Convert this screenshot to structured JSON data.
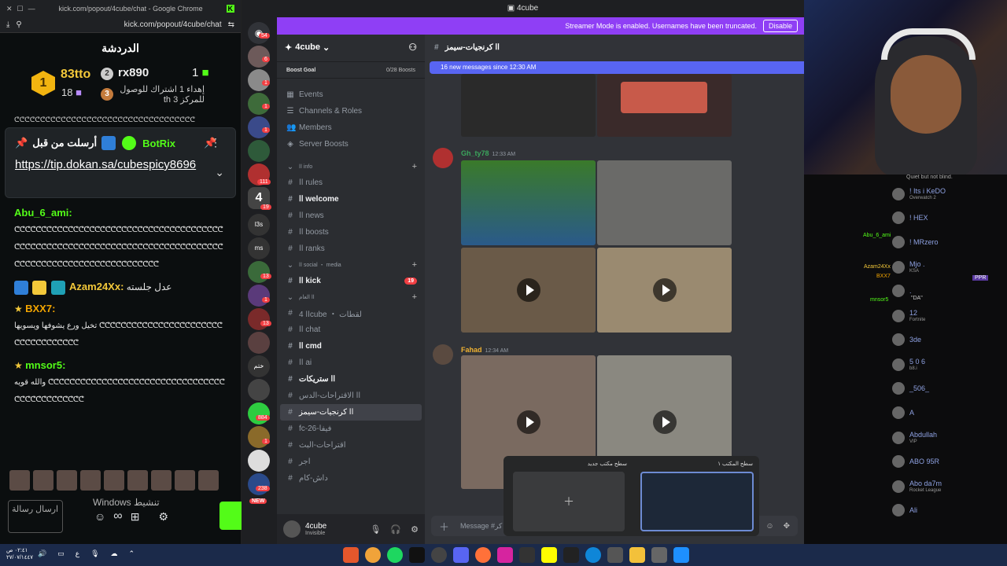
{
  "kick": {
    "chrome_title": "kick.com/popout/4cube/chat - Google Chrome",
    "url": "kick.com/popout/4cube/chat",
    "chat_title": "الدردشة",
    "leaderboard": {
      "first_rank": "1",
      "first_name": "83tto",
      "first_count": "18",
      "second_rank": "2",
      "second_name": "rx890",
      "second_count": "1",
      "third_rank": "3",
      "note": "إهداء 1 اشتراك للوصول للمركز 3 th",
      "separator": "ᕦᕦᕦᕦᕦᕦᕦᕦᕦᕦᕦᕦᕦᕦᕦᕦᕦᕦᕦᕦᕦᕦᕦᕦᕦᕦᕦᕦᕦᕦᕦᕦᕦᕦᕦ"
    },
    "pinned": {
      "prefix": "أرسلت من قبل",
      "bot": "BotRix",
      "link": "https://tip.dokan.sa/cubespicy8696"
    },
    "messages": [
      {
        "user": "Abu_6_ami:",
        "color": "#53fc18",
        "text": "ᕦᕦᕦᕦᕦᕦᕦᕦᕦᕦᕦᕦᕦᕦᕦᕦᕦᕦᕦᕦᕦᕦᕦᕦᕦᕦᕦᕦᕦᕦᕦᕦᕦᕦᕦᕦᕦᕦᕦᕦᕦᕦᕦᕦᕦᕦᕦᕦᕦᕦᕦᕦᕦᕦᕦᕦᕦᕦᕦᕦᕦᕦᕦᕦᕦᕦᕦᕦᕦᕦᕦᕦᕦᕦᕦᕦᕦᕦᕦᕦᕦᕦᕦᕦᕦᕦᕦᕦᕦᕦᕦᕦᕦᕦᕦᕦᕦᕦᕦᕦᕦᕦᕦᕦᕦ"
      },
      {
        "user": "Azam24Xx:",
        "color": "#f3c83a",
        "text": "عدل جلسته"
      },
      {
        "user": "BXX7:",
        "color": "#f3a500",
        "text": "تخيل ورع يشوفها ويسويها ᕦᕦᕦᕦᕦᕦᕦᕦᕦᕦᕦᕦᕦᕦᕦᕦᕦᕦᕦᕦᕦᕦᕦᕦᕦᕦᕦᕦᕦᕦᕦᕦᕦᕦᕦ"
      },
      {
        "user": "mnsor5:",
        "color": "#53fc18",
        "text": "والله قويه ᕦᕦᕦᕦᕦᕦᕦᕦᕦᕦᕦᕦᕦᕦᕦᕦᕦᕦᕦᕦᕦᕦᕦᕦᕦᕦᕦᕦᕦᕦᕦᕦᕦᕦᕦᕦᕦᕦᕦᕦᕦᕦᕦᕦᕦᕦ"
      }
    ],
    "input_placeholder": "ارسال رسالة",
    "watermark": "Windows تنشيط"
  },
  "discord": {
    "window_title": "4cube",
    "banner_text": "Streamer Mode is enabled. Usernames have been truncated.",
    "banner_button": "Disable",
    "server_name": "4cube",
    "boost_goal": "Boost Goal",
    "boost_count": "0/28 Boosts",
    "top_items": [
      "Events",
      "Channels & Roles",
      "Members",
      "Server Boosts"
    ],
    "channels": [
      {
        "label": "اا info",
        "kind": "cat"
      },
      {
        "label": "اا rules",
        "kind": "ch"
      },
      {
        "label": "اا welcome",
        "kind": "bold"
      },
      {
        "label": "اا news",
        "kind": "ch"
      },
      {
        "label": "اا boosts",
        "kind": "ch"
      },
      {
        "label": "اا ranks",
        "kind": "ch"
      },
      {
        "label": "اا social ・ media",
        "kind": "cat"
      },
      {
        "label": "اا kick",
        "kind": "bold",
        "mention": "19"
      },
      {
        "label": "اا العام",
        "kind": "cat"
      },
      {
        "label": "اا 4cube ・ لقطات",
        "kind": "ch"
      },
      {
        "label": "اا chat",
        "kind": "ch"
      },
      {
        "label": "اا cmd",
        "kind": "bold"
      },
      {
        "label": "اا ai",
        "kind": "ch"
      },
      {
        "label": "اا ستريكات",
        "kind": "bold"
      },
      {
        "label": "اا الاقتراحات-الدس",
        "kind": "ch"
      },
      {
        "label": "اا كرنجيات-سيمز",
        "kind": "sel"
      },
      {
        "label": "fc-26-فيفا",
        "kind": "ch"
      },
      {
        "label": "اقتراحات-البث",
        "kind": "ch"
      },
      {
        "label": "اجر",
        "kind": "ch"
      },
      {
        "label": "داش-كام",
        "kind": "ch"
      }
    ],
    "current_channel": "اا كرنجيات-سيمز",
    "new_messages": "16 new messages since 12:30 AM",
    "posts": [
      {
        "name": "Gh_ty78",
        "time": "12:33 AM",
        "color": "#3ba55c"
      },
      {
        "name": "Fahad",
        "time": "12:34 AM",
        "color": "#f0b232"
      }
    ],
    "composer_placeholder": "Message #كر",
    "user": {
      "name": "4cube",
      "status": "Invisible"
    },
    "guild_badges": [
      "54",
      "6",
      "1",
      "1",
      "1",
      "111",
      "19",
      "13",
      "1",
      "13",
      "884",
      "1",
      "238",
      "NEW"
    ],
    "guild_labels": [
      "l3s",
      "ms",
      "ختم"
    ],
    "desktop_preview": {
      "new_desktop": "سطح مكتب جديد",
      "current_desktop": "سطح المكتب ١"
    }
  },
  "overlay": {
    "entries": [
      {
        "name": "! Its i KeDO",
        "sub": "Overwatch 2"
      },
      {
        "name": "! HEX",
        "sub": ""
      },
      {
        "name": "! MRzero",
        "sub": ""
      },
      {
        "name": "Mjo . ",
        "sub": "KSA"
      },
      {
        "name": ".",
        "sub": ""
      },
      {
        "name": "12",
        "sub": "Fortnite"
      },
      {
        "name": "3de",
        "sub": ""
      },
      {
        "name": "5 0 6",
        "sub": "b8.i"
      },
      {
        "name": "_506_",
        "sub": ""
      },
      {
        "name": "A",
        "sub": ""
      },
      {
        "name": "Abdullah",
        "sub": "VIP"
      },
      {
        "name": "ABO 95R",
        "sub": ""
      },
      {
        "name": "Abo da7m",
        "sub": "Rocket League"
      },
      {
        "name": "Ali",
        "sub": ""
      }
    ],
    "top_note": "Quiet but not blind.",
    "floating": [
      "Abu_6_ami",
      "Azam24Xx",
      "BXX7",
      "mnsor5",
      "\"DA\"",
      "PPR"
    ]
  },
  "taskbar": {
    "time": "٠٢:٤١ ص",
    "date": "٢٧/٠٧/١٤٤٧"
  }
}
